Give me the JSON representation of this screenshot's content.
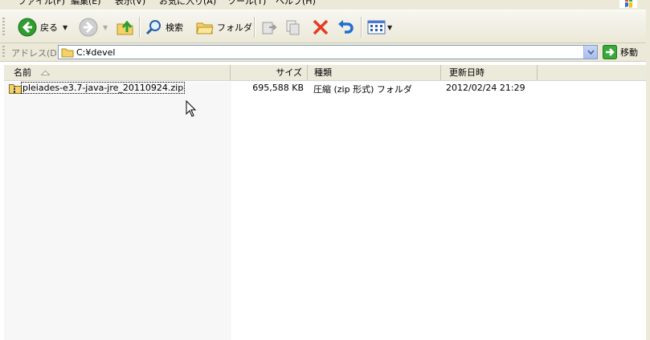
{
  "menu": {
    "items": [
      "ファイル(F)",
      "編集(E)",
      "表示(V)",
      "お気に入り(A)",
      "ツール(T)",
      "ヘルプ(H)"
    ]
  },
  "toolbar": {
    "back_label": "戻る",
    "search_label": "検索",
    "folders_label": "フォルダ"
  },
  "address": {
    "label": "アドレス(D)",
    "path": "C:¥devel",
    "go_label": "移動"
  },
  "columns": {
    "name": "名前",
    "size": "サイズ",
    "type": "種類",
    "modified": "更新日時"
  },
  "files": [
    {
      "name": "pleiades-e3.7-java-jre_20110924.zip",
      "size": "695,588 KB",
      "type": "圧縮 (zip 形式) フォルダ",
      "modified": "2012/02/24 21:29"
    }
  ],
  "colors": {
    "chrome": "#ece9d8",
    "back_green": "#2f9e2f",
    "delete_red": "#e53b22",
    "undo_blue": "#1f6fd0"
  }
}
